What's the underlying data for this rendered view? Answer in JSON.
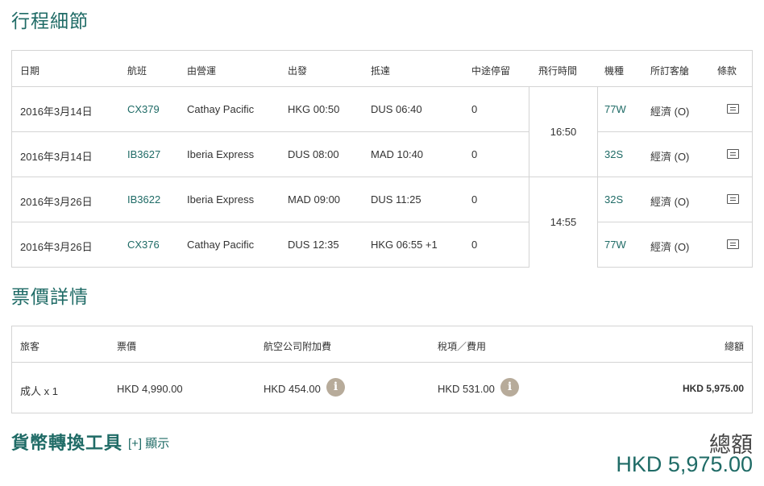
{
  "itinerary": {
    "title": "行程細節",
    "headers": {
      "date": "日期",
      "flight": "航班",
      "operator": "由營運",
      "depart": "出發",
      "arrive": "抵達",
      "stops": "中途停留",
      "duration": "飛行時間",
      "aircraft": "機種",
      "cabin": "所訂客艙",
      "conditions": "條款"
    },
    "rows": [
      {
        "date": "2016年3月14日",
        "flight": "CX379",
        "operator": "Cathay Pacific",
        "depart": "HKG 00:50",
        "arrive": "DUS 06:40",
        "stops": "0",
        "aircraft": "77W",
        "cabin": "經濟 (O)"
      },
      {
        "date": "2016年3月14日",
        "flight": "IB3627",
        "operator": "Iberia Express",
        "depart": "DUS 08:00",
        "arrive": "MAD 10:40",
        "stops": "0",
        "aircraft": "32S",
        "cabin": "經濟 (O)"
      },
      {
        "date": "2016年3月26日",
        "flight": "IB3622",
        "operator": "Iberia Express",
        "depart": "MAD 09:00",
        "arrive": "DUS 11:25",
        "stops": "0",
        "aircraft": "32S",
        "cabin": "經濟 (O)"
      },
      {
        "date": "2016年3月26日",
        "flight": "CX376",
        "operator": "Cathay Pacific",
        "depart": "DUS 12:35",
        "arrive": "HKG 06:55 +1",
        "stops": "0",
        "aircraft": "77W",
        "cabin": "經濟 (O)"
      }
    ],
    "durations": [
      "16:50",
      "14:55"
    ]
  },
  "fare": {
    "title": "票價詳情",
    "headers": {
      "passenger": "旅客",
      "fare": "票價",
      "surcharge": "航空公司附加費",
      "taxes": "稅項／費用",
      "total": "總額"
    },
    "row": {
      "passenger": "成人 x 1",
      "fare": "HKD 4,990.00",
      "surcharge": "HKD 454.00",
      "taxes": "HKD 531.00",
      "total": "HKD 5,975.00"
    },
    "info_icon": "i"
  },
  "currency": {
    "title": "貨幣轉換工具",
    "toggle_label": "[+] 顯示"
  },
  "total": {
    "label": "總額",
    "value": "HKD 5,975.00"
  },
  "icons": {
    "conditions": "document-icon",
    "info": "info-icon"
  },
  "colors": {
    "accent": "#1f6b66",
    "info_badge": "#b7ab9a",
    "border": "#d4d4d4"
  }
}
